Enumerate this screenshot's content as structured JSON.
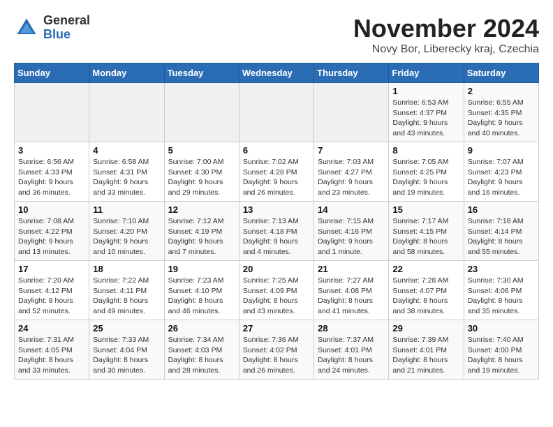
{
  "logo": {
    "general": "General",
    "blue": "Blue"
  },
  "title": "November 2024",
  "subtitle": "Novy Bor, Liberecky kraj, Czechia",
  "days_of_week": [
    "Sunday",
    "Monday",
    "Tuesday",
    "Wednesday",
    "Thursday",
    "Friday",
    "Saturday"
  ],
  "weeks": [
    [
      {
        "day": "",
        "info": ""
      },
      {
        "day": "",
        "info": ""
      },
      {
        "day": "",
        "info": ""
      },
      {
        "day": "",
        "info": ""
      },
      {
        "day": "",
        "info": ""
      },
      {
        "day": "1",
        "info": "Sunrise: 6:53 AM\nSunset: 4:37 PM\nDaylight: 9 hours\nand 43 minutes."
      },
      {
        "day": "2",
        "info": "Sunrise: 6:55 AM\nSunset: 4:35 PM\nDaylight: 9 hours\nand 40 minutes."
      }
    ],
    [
      {
        "day": "3",
        "info": "Sunrise: 6:56 AM\nSunset: 4:33 PM\nDaylight: 9 hours\nand 36 minutes."
      },
      {
        "day": "4",
        "info": "Sunrise: 6:58 AM\nSunset: 4:31 PM\nDaylight: 9 hours\nand 33 minutes."
      },
      {
        "day": "5",
        "info": "Sunrise: 7:00 AM\nSunset: 4:30 PM\nDaylight: 9 hours\nand 29 minutes."
      },
      {
        "day": "6",
        "info": "Sunrise: 7:02 AM\nSunset: 4:28 PM\nDaylight: 9 hours\nand 26 minutes."
      },
      {
        "day": "7",
        "info": "Sunrise: 7:03 AM\nSunset: 4:27 PM\nDaylight: 9 hours\nand 23 minutes."
      },
      {
        "day": "8",
        "info": "Sunrise: 7:05 AM\nSunset: 4:25 PM\nDaylight: 9 hours\nand 19 minutes."
      },
      {
        "day": "9",
        "info": "Sunrise: 7:07 AM\nSunset: 4:23 PM\nDaylight: 9 hours\nand 16 minutes."
      }
    ],
    [
      {
        "day": "10",
        "info": "Sunrise: 7:08 AM\nSunset: 4:22 PM\nDaylight: 9 hours\nand 13 minutes."
      },
      {
        "day": "11",
        "info": "Sunrise: 7:10 AM\nSunset: 4:20 PM\nDaylight: 9 hours\nand 10 minutes."
      },
      {
        "day": "12",
        "info": "Sunrise: 7:12 AM\nSunset: 4:19 PM\nDaylight: 9 hours\nand 7 minutes."
      },
      {
        "day": "13",
        "info": "Sunrise: 7:13 AM\nSunset: 4:18 PM\nDaylight: 9 hours\nand 4 minutes."
      },
      {
        "day": "14",
        "info": "Sunrise: 7:15 AM\nSunset: 4:16 PM\nDaylight: 9 hours\nand 1 minute."
      },
      {
        "day": "15",
        "info": "Sunrise: 7:17 AM\nSunset: 4:15 PM\nDaylight: 8 hours\nand 58 minutes."
      },
      {
        "day": "16",
        "info": "Sunrise: 7:18 AM\nSunset: 4:14 PM\nDaylight: 8 hours\nand 55 minutes."
      }
    ],
    [
      {
        "day": "17",
        "info": "Sunrise: 7:20 AM\nSunset: 4:12 PM\nDaylight: 8 hours\nand 52 minutes."
      },
      {
        "day": "18",
        "info": "Sunrise: 7:22 AM\nSunset: 4:11 PM\nDaylight: 8 hours\nand 49 minutes."
      },
      {
        "day": "19",
        "info": "Sunrise: 7:23 AM\nSunset: 4:10 PM\nDaylight: 8 hours\nand 46 minutes."
      },
      {
        "day": "20",
        "info": "Sunrise: 7:25 AM\nSunset: 4:09 PM\nDaylight: 8 hours\nand 43 minutes."
      },
      {
        "day": "21",
        "info": "Sunrise: 7:27 AM\nSunset: 4:08 PM\nDaylight: 8 hours\nand 41 minutes."
      },
      {
        "day": "22",
        "info": "Sunrise: 7:28 AM\nSunset: 4:07 PM\nDaylight: 8 hours\nand 38 minutes."
      },
      {
        "day": "23",
        "info": "Sunrise: 7:30 AM\nSunset: 4:06 PM\nDaylight: 8 hours\nand 35 minutes."
      }
    ],
    [
      {
        "day": "24",
        "info": "Sunrise: 7:31 AM\nSunset: 4:05 PM\nDaylight: 8 hours\nand 33 minutes."
      },
      {
        "day": "25",
        "info": "Sunrise: 7:33 AM\nSunset: 4:04 PM\nDaylight: 8 hours\nand 30 minutes."
      },
      {
        "day": "26",
        "info": "Sunrise: 7:34 AM\nSunset: 4:03 PM\nDaylight: 8 hours\nand 28 minutes."
      },
      {
        "day": "27",
        "info": "Sunrise: 7:36 AM\nSunset: 4:02 PM\nDaylight: 8 hours\nand 26 minutes."
      },
      {
        "day": "28",
        "info": "Sunrise: 7:37 AM\nSunset: 4:01 PM\nDaylight: 8 hours\nand 24 minutes."
      },
      {
        "day": "29",
        "info": "Sunrise: 7:39 AM\nSunset: 4:01 PM\nDaylight: 8 hours\nand 21 minutes."
      },
      {
        "day": "30",
        "info": "Sunrise: 7:40 AM\nSunset: 4:00 PM\nDaylight: 8 hours\nand 19 minutes."
      }
    ]
  ]
}
